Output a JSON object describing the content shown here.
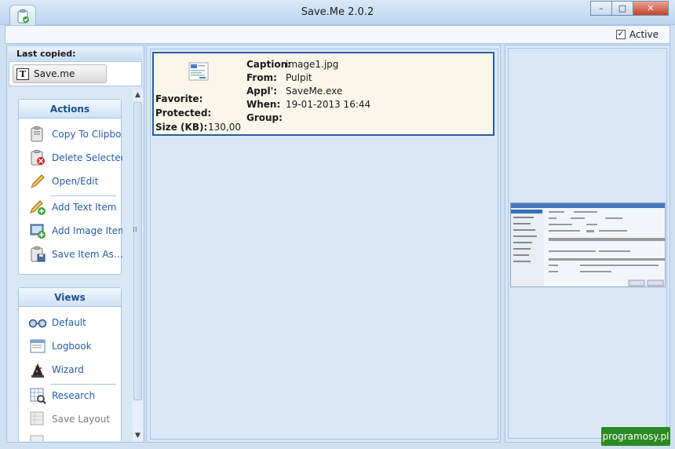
{
  "window": {
    "title": "Save.Me 2.0.2",
    "min_label": "–",
    "max_label": "□",
    "close_label": "✕"
  },
  "toolbar": {
    "active_label": "Active",
    "active_checked": true,
    "check_mark": "✓"
  },
  "last_copied": {
    "heading": "Last copied:",
    "item_label": "Save.me",
    "item_icon_glyph": "T"
  },
  "actions": {
    "heading": "Actions",
    "items": [
      {
        "label": "Copy To Clipbo…",
        "icon": "clipboard-copy-icon"
      },
      {
        "label": "Delete Selected",
        "icon": "clipboard-delete-icon"
      },
      {
        "label": "Open/Edit",
        "icon": "pencil-icon"
      },
      {
        "label": "Add Text Item",
        "icon": "pencil-add-icon"
      },
      {
        "label": "Add Image Item",
        "icon": "image-add-icon"
      },
      {
        "label": "Save Item As…",
        "icon": "save-as-icon"
      }
    ]
  },
  "views": {
    "heading": "Views",
    "items": [
      {
        "label": "Default",
        "icon": "glasses-icon",
        "enabled": true
      },
      {
        "label": "Logbook",
        "icon": "logbook-icon",
        "enabled": true
      },
      {
        "label": "Wizard",
        "icon": "wizard-hat-icon",
        "enabled": true
      },
      {
        "label": "Research",
        "icon": "research-icon",
        "enabled": true
      },
      {
        "label": "Save Layout",
        "icon": "save-layout-icon",
        "enabled": false
      }
    ]
  },
  "clip_item": {
    "caption_label": "Caption:",
    "caption": "image1.jpg",
    "from_label": "From:",
    "from": "Pulpit",
    "appl_label": "Appl':",
    "appl": "SaveMe.exe",
    "when_label": "When:",
    "when": "19-01-2013 16:44",
    "group_label": "Group:",
    "group": "",
    "favorite_label": "Favorite:",
    "protected_label": "Protected:",
    "size_label": "Size (KB):",
    "size": "130,00"
  },
  "scroll": {
    "up": "▲",
    "down": "▼"
  },
  "splitter_glyph": "⁞⁞",
  "watermark": "programosy.pl",
  "colors": {
    "accent": "#2c5b9c",
    "link": "#2a5aa8",
    "card_bg": "#fbf6ea",
    "panel_bg": "#dae8f6"
  }
}
